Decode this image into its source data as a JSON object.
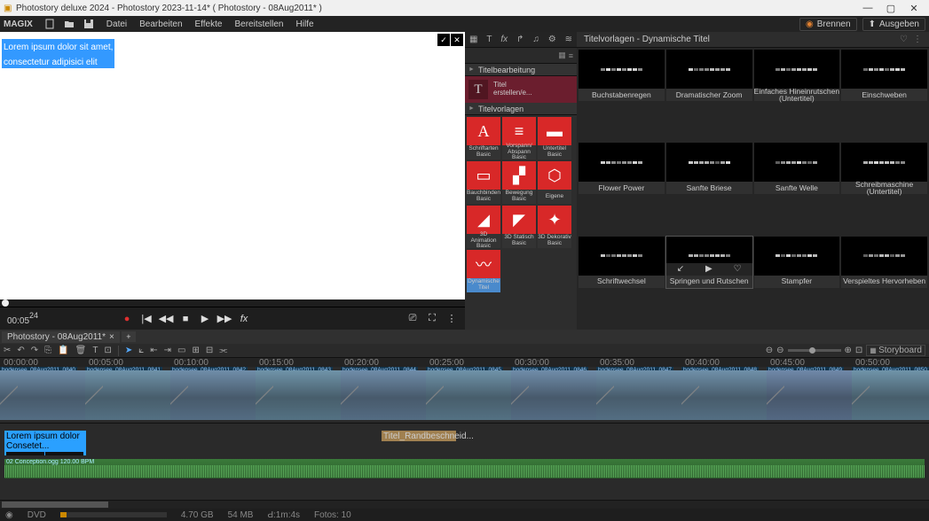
{
  "window": {
    "title": "Photostory deluxe 2024 - Photostory 2023-11-14* ( Photostory - 08Aug2011* )"
  },
  "menubar": {
    "logo": "MAGIX",
    "items": [
      "Datei",
      "Bearbeiten",
      "Effekte",
      "Bereitstellen",
      "Hilfe"
    ],
    "actions": {
      "burn": "Brennen",
      "export": "Ausgeben"
    }
  },
  "preview": {
    "selected_text": "Lorem ipsum dolor sit amet,\nconsectetur adipisici elit",
    "time": "00:05",
    "frames": "24"
  },
  "midpanel": {
    "section1": "Titelbearbeitung",
    "title_create_label": "Titel\nerstellen/e...",
    "section2": "Titelvorlagen",
    "tiles": [
      "Schriftarten Basic",
      "Vorspann/ Abspann Basic",
      "Untertitel Basic",
      "Bauchbinden Basic",
      "Bewegung Basic",
      "Eigene",
      "3D Animation Basic",
      "3D Statisch Basic",
      "3D Dekorativ Basic",
      "Dynamische Titel"
    ]
  },
  "rightpanel": {
    "header": "Titelvorlagen - Dynamische Titel",
    "items": [
      "Buchstabenregen",
      "Dramatischer Zoom",
      "Einfaches Hineinrutschen (Untertitel)",
      "Einschweben",
      "Flower Power",
      "Sanfte Briese",
      "Sanfte Welle",
      "Schreibmaschine (Untertitel)",
      "Schriftwechsel",
      "Springen und Rutschen",
      "Stampfer",
      "Verspieltes Hervorheben"
    ]
  },
  "timeline": {
    "tab": "Photostory - 08Aug2011*",
    "ruler": [
      "00:00:00",
      "00:05:00",
      "00:10:00",
      "00:15:00",
      "00:20:00",
      "00:25:00",
      "00:30:00",
      "00:35:00",
      "00:40:00",
      "00:45:00",
      "00:50:00"
    ],
    "cliplabel": "bodensee_08Aug2011_08",
    "titleclip": "Lorem ipsum dolor Consetet...",
    "fxclip": "Titel_Randbeschneid...",
    "audioclip": "02 Conception.ogg  120.00 BPM",
    "storyboard_btn": "Storyboard"
  },
  "status": {
    "dvd": "DVD",
    "space": "4.70 GB",
    "mem": "54 MB",
    "dur": "Ԁ:1m:4s",
    "fotos": "Fotos: 10"
  }
}
